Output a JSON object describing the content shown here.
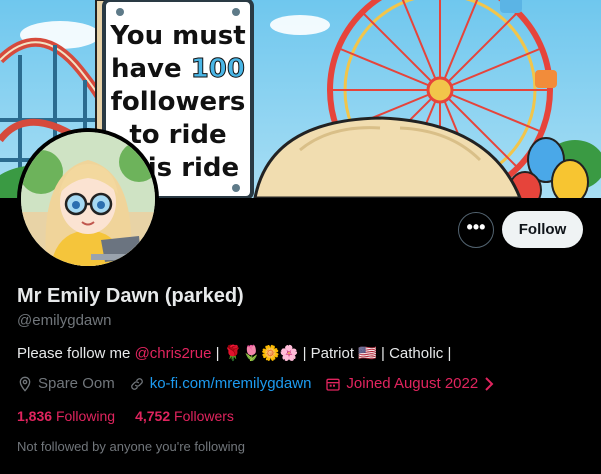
{
  "banner": {
    "sign_line1": "You must",
    "sign_line2_a": "have",
    "sign_line2_b": "100",
    "sign_line3": "followers",
    "sign_line4": "to ride",
    "sign_line5": "this ride"
  },
  "actions": {
    "more_label": "•••",
    "follow_label": "Follow"
  },
  "profile": {
    "display_name": "Mr Emily Dawn (parked)",
    "handle": "@emilygdawn",
    "bio_prefix": "Please follow me",
    "bio_mention": "@chris2rue",
    "bio_emojis": "| 🌹🌷🌼🌸 | Patriot 🇺🇸 | Catholic |",
    "location": "Spare Oom",
    "website": "ko-fi.com/mremilygdawn",
    "joined": "Joined August 2022",
    "following_count": "1,836",
    "following_label": "Following",
    "followers_count": "4,752",
    "followers_label": "Followers",
    "not_followed_text": "Not followed by anyone you're following"
  },
  "colors": {
    "background": "#000000",
    "accent_link": "#1d9bf0",
    "accent_pink": "#e0245e",
    "muted": "#71767b"
  }
}
